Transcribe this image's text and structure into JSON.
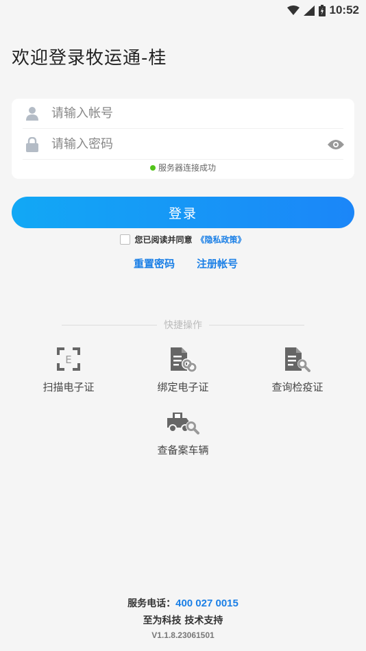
{
  "status_bar": {
    "time": "10:52",
    "icons": [
      "wifi-icon",
      "signal-icon",
      "battery-icon"
    ]
  },
  "welcome_title": "欢迎登录牧运通-桂",
  "login_form": {
    "account_placeholder": "请输入帐号",
    "password_placeholder": "请输入密码",
    "account_value": "",
    "password_value": "",
    "server_status": "服务器连接成功"
  },
  "login_button": "登录",
  "agreement": {
    "text": "您已阅读并同意",
    "link": "《隐私政策》"
  },
  "links": {
    "reset_password": "重置密码",
    "register": "注册帐号"
  },
  "quick_actions": {
    "title": "快捷操作",
    "items": [
      {
        "label": "扫描电子证",
        "icon": "scan-icon"
      },
      {
        "label": "绑定电子证",
        "icon": "link-document-icon"
      },
      {
        "label": "查询检疫证",
        "icon": "search-document-icon"
      },
      {
        "label": "查备案车辆",
        "icon": "truck-search-icon"
      }
    ]
  },
  "footer": {
    "phone_label": "服务电话：",
    "phone": "400 027 0015",
    "support": "至为科技 技术支持",
    "version": "V1.1.8.23061501"
  },
  "colors": {
    "accent": "#1a7fe6",
    "button_start": "#12a8f5",
    "button_end": "#1b86f8",
    "status_ok": "#52c41a",
    "icon_gray": "#666666",
    "background": "#f5f5f5"
  }
}
